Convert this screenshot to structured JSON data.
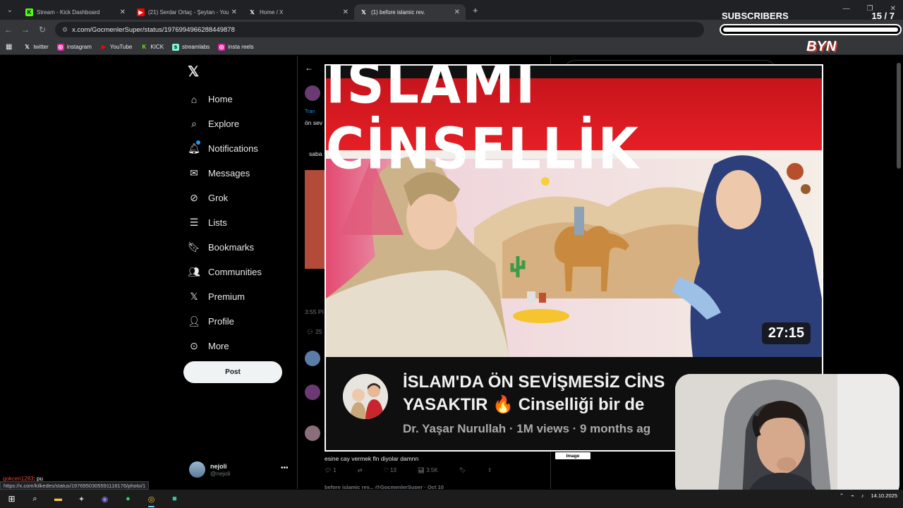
{
  "browser": {
    "tabs": [
      {
        "title": "Stream - Kick Dashboard",
        "icon": "kick-icon",
        "active": false
      },
      {
        "title": "(21) Serdar Ortaç - Şeytan - You",
        "icon": "youtube-icon",
        "active": false
      },
      {
        "title": "Home / X",
        "icon": "x-icon",
        "active": false
      },
      {
        "title": "(1) before islamic rev.",
        "icon": "x-icon",
        "active": true
      }
    ],
    "url": "x.com/GocmenlerSuper/status/1976994966288449878",
    "bookmarks": [
      {
        "label": "twitter",
        "icon": "x-icon"
      },
      {
        "label": "instagram",
        "icon": "instagram-icon"
      },
      {
        "label": "YouTube",
        "icon": "youtube-icon"
      },
      {
        "label": "KICK",
        "icon": "kick-icon"
      },
      {
        "label": "streamlabs",
        "icon": "streamlabs-icon"
      },
      {
        "label": "insta reels",
        "icon": "instagram-icon"
      }
    ],
    "status_url": "https://x.com/kilkedes/status/1976950305591116176/photo/1"
  },
  "x": {
    "nav": [
      {
        "label": "Home",
        "icon": "home-icon"
      },
      {
        "label": "Explore",
        "icon": "search-icon"
      },
      {
        "label": "Notifications",
        "icon": "bell-icon"
      },
      {
        "label": "Messages",
        "icon": "mail-icon"
      },
      {
        "label": "Grok",
        "icon": "grok-icon"
      },
      {
        "label": "Lists",
        "icon": "list-icon"
      },
      {
        "label": "Bookmarks",
        "icon": "bookmark-icon"
      },
      {
        "label": "Communities",
        "icon": "people-icon"
      },
      {
        "label": "Premium",
        "icon": "x-icon"
      },
      {
        "label": "Profile",
        "icon": "person-icon"
      },
      {
        "label": "More",
        "icon": "more-circle-icon"
      }
    ],
    "post_label": "Post",
    "account": {
      "name": "nejoli",
      "handle": "@nejoli"
    },
    "timeline": {
      "translate_snip": "Tran",
      "text_snip": "ön sev",
      "quote_snip": "saba",
      "time_snip": "3:55 PI",
      "reply_count_snip": "25",
      "reply_text": "esine cay vermek fln diyolar damnn",
      "actions": {
        "replies": "1",
        "likes": "13",
        "views": "3.5K"
      },
      "bottom_snip": "before islamic rev... @GocmenlerSuper · Oct 10"
    },
    "image_badge": "Image"
  },
  "video": {
    "headline": "İSLAMİ CİNSELLİK",
    "duration": "27:15",
    "title_line1": "İSLAM'DA ÖN SEVİŞMESİZ CİNS",
    "title_line2": "YASAKTIR 🔥 Cinselliği bir de",
    "meta": "Dr. Yaşar Nurullah · 1M views · 9 months ag"
  },
  "overlay": {
    "subscribers_label": "SUBSCRIBERS",
    "subscribers_count": "15 / 7",
    "subscribers_progress": 1.0,
    "brand_text": "BYN"
  },
  "chat": {
    "user": "gokcen1283",
    "message": ": pu"
  },
  "taskbar": {
    "date": "14.10.2025"
  }
}
